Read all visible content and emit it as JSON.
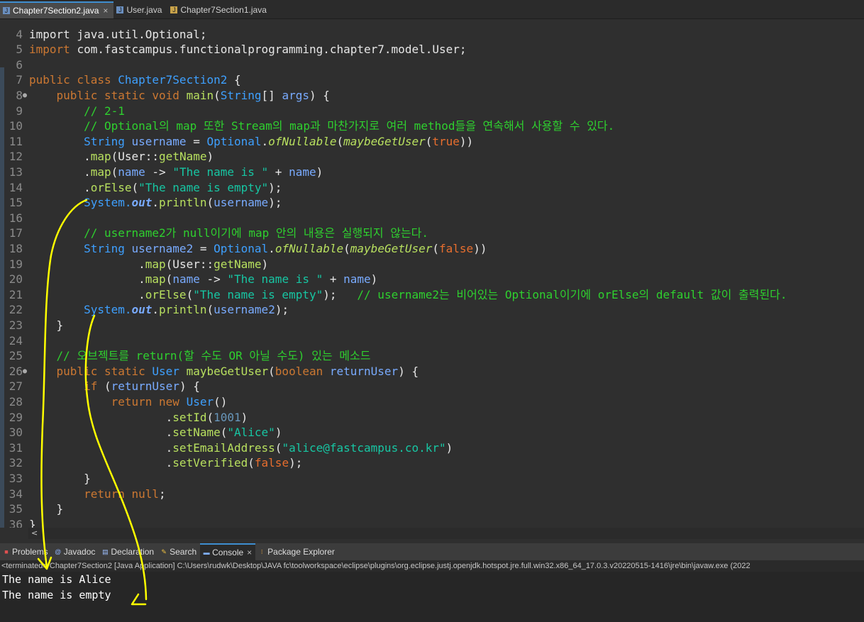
{
  "tabs": [
    {
      "label": "Chapter7Section2.java",
      "icon": "java-file-icon",
      "active": true,
      "close": "×"
    },
    {
      "label": "User.java",
      "icon": "java-file-icon",
      "active": false
    },
    {
      "label": "Chapter7Section1.java",
      "icon": "java-file-icon",
      "active": false
    }
  ],
  "code": {
    "top_partial": "import java.util.Optional;",
    "lines": [
      {
        "n": "4"
      },
      {
        "n": "5",
        "t1": "import ",
        "t2": "com.fastcampus.functionalprogramming.chapter7.model.User;"
      },
      {
        "n": "6"
      },
      {
        "n": "7",
        "t1": "public class ",
        "t2": "Chapter7Section2",
        "t3": " {"
      },
      {
        "n": "8",
        "fold": "●",
        "t1": "    public static void ",
        "t2": "main",
        "t3": "(",
        "t4": "String",
        "t5": "[] ",
        "t6": "args",
        "t7": ") {"
      },
      {
        "n": "9",
        "t1": "        // 2-1"
      },
      {
        "n": "10",
        "t1": "        // Optional의 map 또한 Stream의 map과 마찬가지로 여러 method들을 연속해서 사용할 수 있다."
      },
      {
        "n": "11",
        "t1": "        String ",
        "t2": "username",
        "t3": " = ",
        "t4": "Optional",
        "t5": ".",
        "t6": "ofNullable",
        "t7": "(",
        "t8": "maybeGetUser",
        "t9": "(",
        "t10": "true",
        "t11": "))"
      },
      {
        "n": "12",
        "t1": "        .",
        "t2": "map",
        "t3": "(User::",
        "t4": "getName",
        "t5": ")"
      },
      {
        "n": "13",
        "t1": "        .",
        "t2": "map",
        "t3": "(",
        "t4": "name",
        "t5": " -> ",
        "t6": "\"The name is \"",
        "t7": " + ",
        "t8": "name",
        "t9": ")"
      },
      {
        "n": "14",
        "t1": "        .",
        "t2": "orElse",
        "t3": "(",
        "t4": "\"The name is empty\"",
        "t5": ");"
      },
      {
        "n": "15",
        "t1": "        System.",
        "t2": "out",
        "t3": ".",
        "t4": "println",
        "t5": "(",
        "t6": "username",
        "t7": ");"
      },
      {
        "n": "16"
      },
      {
        "n": "17",
        "t1": "        // username2가 null이기에 map 안의 내용은 실행되지 않는다."
      },
      {
        "n": "18",
        "t1": "        String ",
        "t2": "username2",
        "t3": " = ",
        "t4": "Optional",
        "t5": ".",
        "t6": "ofNullable",
        "t7": "(",
        "t8": "maybeGetUser",
        "t9": "(",
        "t10": "false",
        "t11": "))"
      },
      {
        "n": "19",
        "t1": "                .",
        "t2": "map",
        "t3": "(User::",
        "t4": "getName",
        "t5": ")"
      },
      {
        "n": "20",
        "t1": "                .",
        "t2": "map",
        "t3": "(",
        "t4": "name",
        "t5": " -> ",
        "t6": "\"The name is \"",
        "t7": " + ",
        "t8": "name",
        "t9": ")"
      },
      {
        "n": "21",
        "t1": "                .",
        "t2": "orElse",
        "t3": "(",
        "t4": "\"The name is empty\"",
        "t5": ");   ",
        "t6": "// username2는 비어있는 Optional이기에 orElse의 default 값이 출력된다."
      },
      {
        "n": "22",
        "t1": "        System.",
        "t2": "out",
        "t3": ".",
        "t4": "println",
        "t5": "(",
        "t6": "username2",
        "t7": ");"
      },
      {
        "n": "23",
        "t1": "    }"
      },
      {
        "n": "24"
      },
      {
        "n": "25",
        "t1": "    // 오브젝트를 return(할 수도 OR 아닐 수도) 있는 메소드"
      },
      {
        "n": "26",
        "fold": "●",
        "t1": "    public static ",
        "t2": "User ",
        "t3": "maybeGetUser",
        "t4": "(",
        "t5": "boolean ",
        "t6": "returnUser",
        "t7": ") {"
      },
      {
        "n": "27",
        "t1": "        if ",
        "t2": "(",
        "t3": "returnUser",
        "t4": ") {"
      },
      {
        "n": "28",
        "t1": "            return new ",
        "t2": "User",
        "t3": "()"
      },
      {
        "n": "29",
        "t1": "                    .",
        "t2": "setId",
        "t3": "(",
        "t4": "1001",
        "t5": ")"
      },
      {
        "n": "30",
        "t1": "                    .",
        "t2": "setName",
        "t3": "(",
        "t4": "\"Alice\"",
        "t5": ")"
      },
      {
        "n": "31",
        "t1": "                    .",
        "t2": "setEmailAddress",
        "t3": "(",
        "t4": "\"alice@fastcampus.co.kr\"",
        "t5": ")"
      },
      {
        "n": "32",
        "t1": "                    .",
        "t2": "setVerified",
        "t3": "(",
        "t4": "false",
        "t5": ");"
      },
      {
        "n": "33",
        "t1": "        }"
      },
      {
        "n": "34",
        "t1": "        return ",
        "t2": "null",
        "t3": ";"
      },
      {
        "n": "35",
        "t1": "    }"
      },
      {
        "n": "36",
        "t1": "}"
      }
    ]
  },
  "hscroll_arrow": "<",
  "panel_tabs": [
    {
      "label": "Problems",
      "icon": "problems-icon"
    },
    {
      "label": "Javadoc",
      "icon": "javadoc-icon"
    },
    {
      "label": "Declaration",
      "icon": "declaration-icon"
    },
    {
      "label": "Search",
      "icon": "search-icon"
    },
    {
      "label": "Console",
      "icon": "console-icon",
      "active": true,
      "close": "×"
    },
    {
      "label": "Package Explorer",
      "icon": "package-explorer-icon"
    }
  ],
  "console": {
    "status": "<terminated> Chapter7Section2 [Java Application] C:\\Users\\rudwk\\Desktop\\JAVA fc\\toolworkspace\\eclipse\\plugins\\org.eclipse.justj.openjdk.hotspot.jre.full.win32.x86_64_17.0.3.v20220515-1416\\jre\\bin\\javaw.exe  (2022",
    "output": [
      "The name is Alice",
      "The name is empty"
    ]
  },
  "colors": {
    "annotation": "#ffff00",
    "active_tab_border": "#3e8ed0"
  }
}
